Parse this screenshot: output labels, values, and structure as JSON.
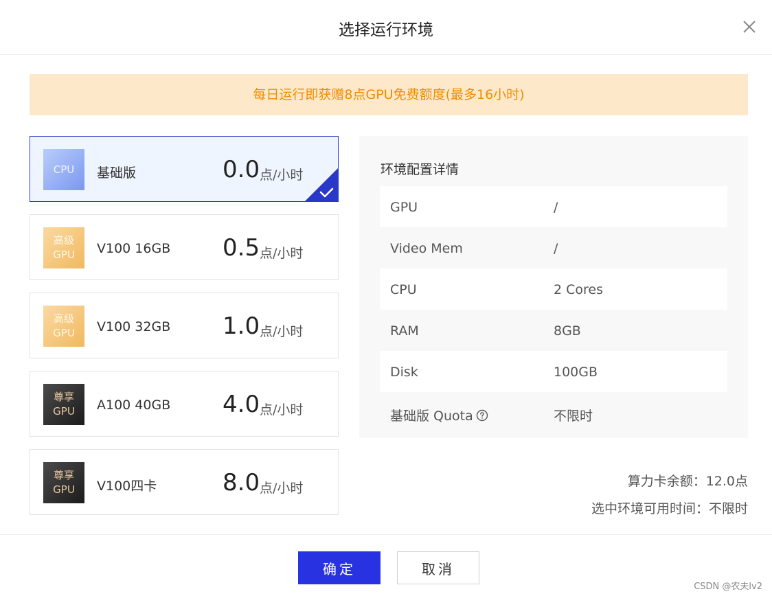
{
  "dialog": {
    "title": "选择运行环境",
    "notice": "每日运行即获赠8点GPU免费额度(最多16小时)"
  },
  "cards": [
    {
      "chip_line1": "CPU",
      "chip_line2": "",
      "name": "基础版",
      "price": "0.0",
      "unit": "点/小时",
      "selected": true
    },
    {
      "chip_line1": "高级",
      "chip_line2": "GPU",
      "name": "V100 16GB",
      "price": "0.5",
      "unit": "点/小时",
      "selected": false
    },
    {
      "chip_line1": "高级",
      "chip_line2": "GPU",
      "name": "V100 32GB",
      "price": "1.0",
      "unit": "点/小时",
      "selected": false
    },
    {
      "chip_line1": "尊享",
      "chip_line2": "GPU",
      "name": "A100 40GB",
      "price": "4.0",
      "unit": "点/小时",
      "selected": false
    },
    {
      "chip_line1": "尊享",
      "chip_line2": "GPU",
      "name": "V100四卡",
      "price": "8.0",
      "unit": "点/小时",
      "selected": false
    }
  ],
  "details": {
    "title": "环境配置详情",
    "rows": [
      {
        "label": "GPU",
        "value": "/"
      },
      {
        "label": "Video Mem",
        "value": "/"
      },
      {
        "label": "CPU",
        "value": "2 Cores"
      },
      {
        "label": "RAM",
        "value": "8GB"
      },
      {
        "label": "Disk",
        "value": "100GB"
      },
      {
        "label": "基础版 Quota",
        "value": "不限时"
      }
    ]
  },
  "summary": {
    "balance": "算力卡余额：12.0点",
    "available_time": "选中环境可用时间：不限时"
  },
  "footer": {
    "ok_label": "确定",
    "cancel_label": "取消",
    "watermark": "CSDN @农夫lv2"
  },
  "icons": {
    "close": "close-icon",
    "check": "check-icon",
    "help": "help-icon"
  },
  "colors": {
    "primary": "#2932e1",
    "selected_border": "#2938c9",
    "notice_bg": "#fde9c9",
    "notice_text": "#f08c00"
  }
}
